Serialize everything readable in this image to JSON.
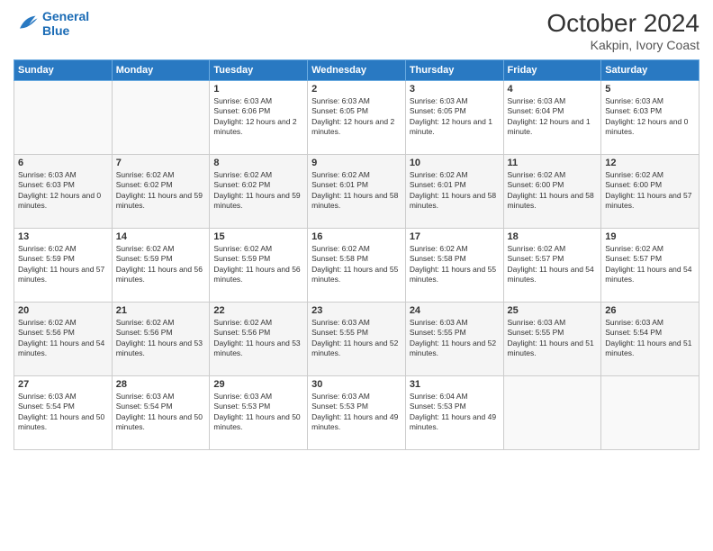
{
  "header": {
    "logo_line1": "General",
    "logo_line2": "Blue",
    "month": "October 2024",
    "location": "Kakpin, Ivory Coast"
  },
  "days_of_week": [
    "Sunday",
    "Monday",
    "Tuesday",
    "Wednesday",
    "Thursday",
    "Friday",
    "Saturday"
  ],
  "weeks": [
    [
      {
        "day": "",
        "sunrise": "",
        "sunset": "",
        "daylight": ""
      },
      {
        "day": "",
        "sunrise": "",
        "sunset": "",
        "daylight": ""
      },
      {
        "day": "1",
        "sunrise": "Sunrise: 6:03 AM",
        "sunset": "Sunset: 6:06 PM",
        "daylight": "Daylight: 12 hours and 2 minutes."
      },
      {
        "day": "2",
        "sunrise": "Sunrise: 6:03 AM",
        "sunset": "Sunset: 6:05 PM",
        "daylight": "Daylight: 12 hours and 2 minutes."
      },
      {
        "day": "3",
        "sunrise": "Sunrise: 6:03 AM",
        "sunset": "Sunset: 6:05 PM",
        "daylight": "Daylight: 12 hours and 1 minute."
      },
      {
        "day": "4",
        "sunrise": "Sunrise: 6:03 AM",
        "sunset": "Sunset: 6:04 PM",
        "daylight": "Daylight: 12 hours and 1 minute."
      },
      {
        "day": "5",
        "sunrise": "Sunrise: 6:03 AM",
        "sunset": "Sunset: 6:03 PM",
        "daylight": "Daylight: 12 hours and 0 minutes."
      }
    ],
    [
      {
        "day": "6",
        "sunrise": "Sunrise: 6:03 AM",
        "sunset": "Sunset: 6:03 PM",
        "daylight": "Daylight: 12 hours and 0 minutes."
      },
      {
        "day": "7",
        "sunrise": "Sunrise: 6:02 AM",
        "sunset": "Sunset: 6:02 PM",
        "daylight": "Daylight: 11 hours and 59 minutes."
      },
      {
        "day": "8",
        "sunrise": "Sunrise: 6:02 AM",
        "sunset": "Sunset: 6:02 PM",
        "daylight": "Daylight: 11 hours and 59 minutes."
      },
      {
        "day": "9",
        "sunrise": "Sunrise: 6:02 AM",
        "sunset": "Sunset: 6:01 PM",
        "daylight": "Daylight: 11 hours and 58 minutes."
      },
      {
        "day": "10",
        "sunrise": "Sunrise: 6:02 AM",
        "sunset": "Sunset: 6:01 PM",
        "daylight": "Daylight: 11 hours and 58 minutes."
      },
      {
        "day": "11",
        "sunrise": "Sunrise: 6:02 AM",
        "sunset": "Sunset: 6:00 PM",
        "daylight": "Daylight: 11 hours and 58 minutes."
      },
      {
        "day": "12",
        "sunrise": "Sunrise: 6:02 AM",
        "sunset": "Sunset: 6:00 PM",
        "daylight": "Daylight: 11 hours and 57 minutes."
      }
    ],
    [
      {
        "day": "13",
        "sunrise": "Sunrise: 6:02 AM",
        "sunset": "Sunset: 5:59 PM",
        "daylight": "Daylight: 11 hours and 57 minutes."
      },
      {
        "day": "14",
        "sunrise": "Sunrise: 6:02 AM",
        "sunset": "Sunset: 5:59 PM",
        "daylight": "Daylight: 11 hours and 56 minutes."
      },
      {
        "day": "15",
        "sunrise": "Sunrise: 6:02 AM",
        "sunset": "Sunset: 5:59 PM",
        "daylight": "Daylight: 11 hours and 56 minutes."
      },
      {
        "day": "16",
        "sunrise": "Sunrise: 6:02 AM",
        "sunset": "Sunset: 5:58 PM",
        "daylight": "Daylight: 11 hours and 55 minutes."
      },
      {
        "day": "17",
        "sunrise": "Sunrise: 6:02 AM",
        "sunset": "Sunset: 5:58 PM",
        "daylight": "Daylight: 11 hours and 55 minutes."
      },
      {
        "day": "18",
        "sunrise": "Sunrise: 6:02 AM",
        "sunset": "Sunset: 5:57 PM",
        "daylight": "Daylight: 11 hours and 54 minutes."
      },
      {
        "day": "19",
        "sunrise": "Sunrise: 6:02 AM",
        "sunset": "Sunset: 5:57 PM",
        "daylight": "Daylight: 11 hours and 54 minutes."
      }
    ],
    [
      {
        "day": "20",
        "sunrise": "Sunrise: 6:02 AM",
        "sunset": "Sunset: 5:56 PM",
        "daylight": "Daylight: 11 hours and 54 minutes."
      },
      {
        "day": "21",
        "sunrise": "Sunrise: 6:02 AM",
        "sunset": "Sunset: 5:56 PM",
        "daylight": "Daylight: 11 hours and 53 minutes."
      },
      {
        "day": "22",
        "sunrise": "Sunrise: 6:02 AM",
        "sunset": "Sunset: 5:56 PM",
        "daylight": "Daylight: 11 hours and 53 minutes."
      },
      {
        "day": "23",
        "sunrise": "Sunrise: 6:03 AM",
        "sunset": "Sunset: 5:55 PM",
        "daylight": "Daylight: 11 hours and 52 minutes."
      },
      {
        "day": "24",
        "sunrise": "Sunrise: 6:03 AM",
        "sunset": "Sunset: 5:55 PM",
        "daylight": "Daylight: 11 hours and 52 minutes."
      },
      {
        "day": "25",
        "sunrise": "Sunrise: 6:03 AM",
        "sunset": "Sunset: 5:55 PM",
        "daylight": "Daylight: 11 hours and 51 minutes."
      },
      {
        "day": "26",
        "sunrise": "Sunrise: 6:03 AM",
        "sunset": "Sunset: 5:54 PM",
        "daylight": "Daylight: 11 hours and 51 minutes."
      }
    ],
    [
      {
        "day": "27",
        "sunrise": "Sunrise: 6:03 AM",
        "sunset": "Sunset: 5:54 PM",
        "daylight": "Daylight: 11 hours and 50 minutes."
      },
      {
        "day": "28",
        "sunrise": "Sunrise: 6:03 AM",
        "sunset": "Sunset: 5:54 PM",
        "daylight": "Daylight: 11 hours and 50 minutes."
      },
      {
        "day": "29",
        "sunrise": "Sunrise: 6:03 AM",
        "sunset": "Sunset: 5:53 PM",
        "daylight": "Daylight: 11 hours and 50 minutes."
      },
      {
        "day": "30",
        "sunrise": "Sunrise: 6:03 AM",
        "sunset": "Sunset: 5:53 PM",
        "daylight": "Daylight: 11 hours and 49 minutes."
      },
      {
        "day": "31",
        "sunrise": "Sunrise: 6:04 AM",
        "sunset": "Sunset: 5:53 PM",
        "daylight": "Daylight: 11 hours and 49 minutes."
      },
      {
        "day": "",
        "sunrise": "",
        "sunset": "",
        "daylight": ""
      },
      {
        "day": "",
        "sunrise": "",
        "sunset": "",
        "daylight": ""
      }
    ]
  ]
}
